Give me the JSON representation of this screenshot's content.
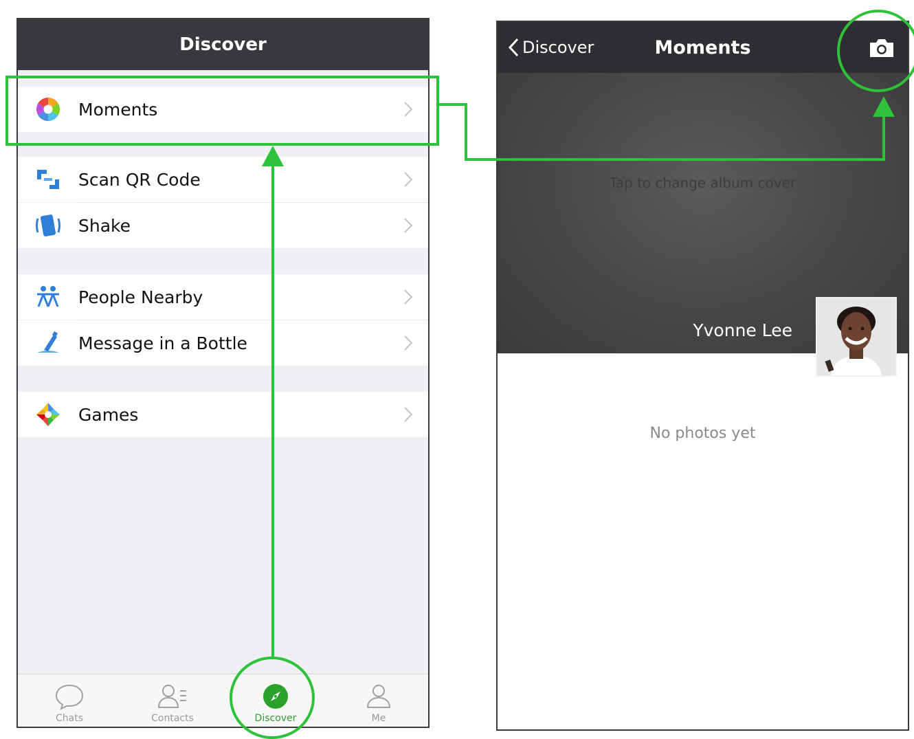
{
  "left_screen": {
    "title": "Discover",
    "items": [
      {
        "label": "Moments",
        "icon": "moments-icon"
      },
      {
        "label": "Scan QR Code",
        "icon": "scan-qr-icon"
      },
      {
        "label": "Shake",
        "icon": "shake-icon"
      },
      {
        "label": "People Nearby",
        "icon": "people-nearby-icon"
      },
      {
        "label": "Message in a Bottle",
        "icon": "bottle-icon"
      },
      {
        "label": "Games",
        "icon": "games-icon"
      }
    ],
    "tabs": [
      {
        "label": "Chats",
        "icon": "chat-bubble-icon"
      },
      {
        "label": "Contacts",
        "icon": "contacts-icon"
      },
      {
        "label": "Discover",
        "icon": "compass-icon",
        "active": true
      },
      {
        "label": "Me",
        "icon": "person-icon"
      }
    ]
  },
  "right_screen": {
    "back_label": "Discover",
    "title": "Moments",
    "cover_hint": "Tap to change album cover",
    "user_name": "Yvonne Lee",
    "empty_text": "No photos yet"
  },
  "colors": {
    "highlight_green": "#2ec13a",
    "navbar_dark": "#38383d",
    "active_tab_green": "#2ba02b"
  }
}
